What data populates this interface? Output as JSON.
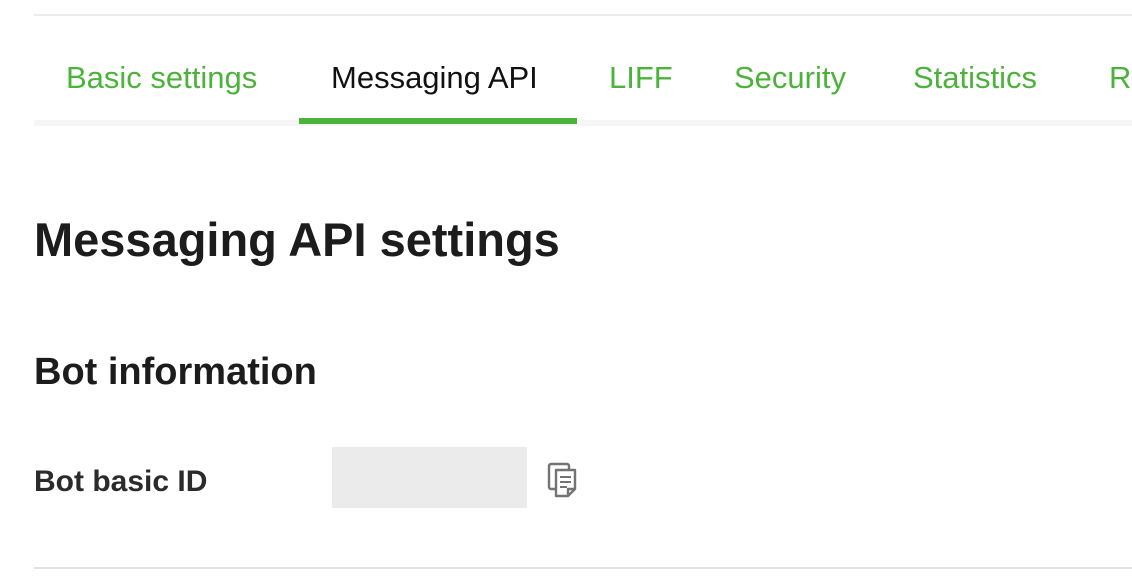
{
  "tabs": [
    {
      "label": "Basic settings",
      "active": false
    },
    {
      "label": "Messaging API",
      "active": true
    },
    {
      "label": "LIFF",
      "active": false
    },
    {
      "label": "Security",
      "active": false
    },
    {
      "label": "Statistics",
      "active": false
    },
    {
      "label": "Roles",
      "active": false
    }
  ],
  "page": {
    "title": "Messaging API settings"
  },
  "section": {
    "title": "Bot information"
  },
  "fields": {
    "bot_basic_id": {
      "label": "Bot basic ID",
      "value": "",
      "copy_icon": "copy-icon"
    }
  },
  "colors": {
    "accent": "#4cb33a",
    "active_tab_text": "#111111",
    "heading": "#1c1c1c",
    "redacted_value_bg": "#ebebeb",
    "divider": "#e3e3e3"
  }
}
